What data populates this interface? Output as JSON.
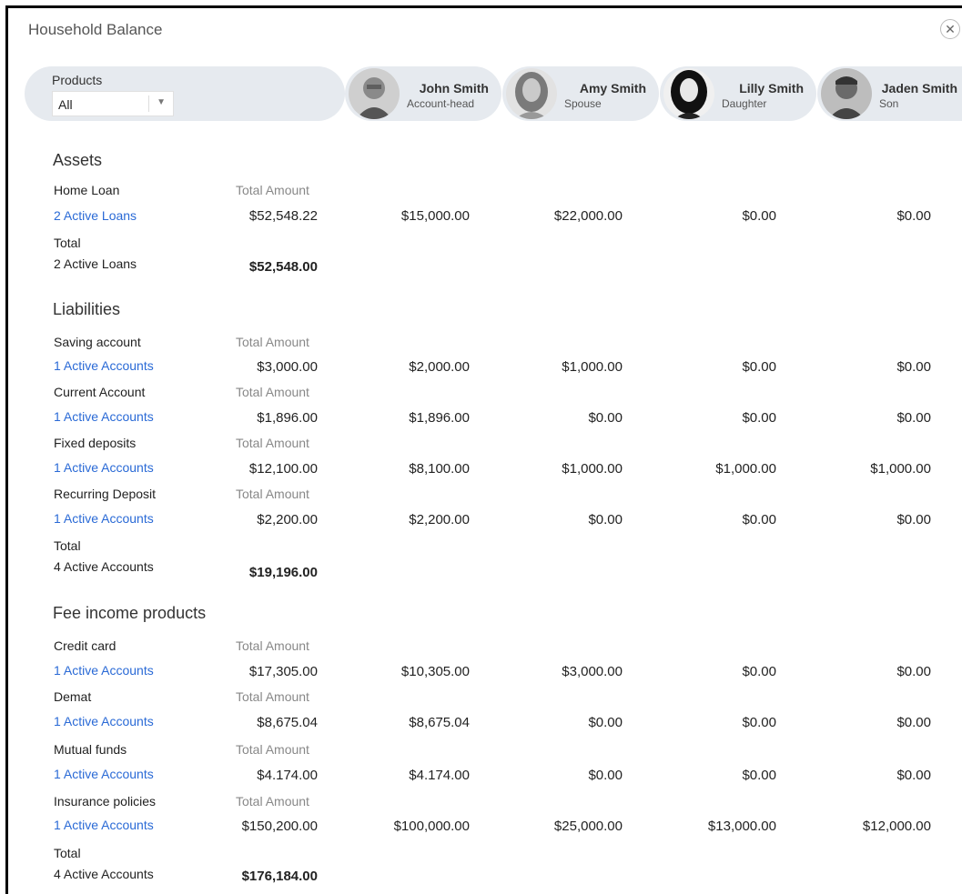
{
  "window": {
    "title": "Household Balance",
    "close_icon": "close-icon"
  },
  "filter": {
    "label": "Products",
    "value": "All"
  },
  "members": [
    {
      "name": "John Smith",
      "role": "Account-head"
    },
    {
      "name": "Amy Smith",
      "role": "Spouse"
    },
    {
      "name": "Lilly Smith",
      "role": "Daughter"
    },
    {
      "name": "Jaden Smith",
      "role": "Son"
    }
  ],
  "total_amount_label": "Total Amount",
  "total_label": "Total",
  "sections": [
    {
      "title": "Assets",
      "rows": [
        {
          "label": "Home Loan",
          "link": "2 Active Loans",
          "values": [
            "$52,548.22",
            "$15,000.00",
            "$22,000.00",
            "$0.00",
            "$0.00"
          ]
        }
      ],
      "total_count": "2 Active Loans",
      "total_value": "$52,548.00"
    },
    {
      "title": "Liabilities",
      "rows": [
        {
          "label": "Saving account",
          "link": "1 Active Accounts",
          "values": [
            "$3,000.00",
            "$2,000.00",
            "$1,000.00",
            "$0.00",
            "$0.00"
          ]
        },
        {
          "label": "Current Account",
          "link": "1 Active Accounts",
          "values": [
            "$1,896.00",
            "$1,896.00",
            "$0.00",
            "$0.00",
            "$0.00"
          ]
        },
        {
          "label": "Fixed deposits",
          "link": "1 Active Accounts",
          "values": [
            "$12,100.00",
            "$8,100.00",
            "$1,000.00",
            "$1,000.00",
            "$1,000.00"
          ]
        },
        {
          "label": "Recurring Deposit",
          "link": "1 Active Accounts",
          "values": [
            "$2,200.00",
            "$2,200.00",
            "$0.00",
            "$0.00",
            "$0.00"
          ]
        }
      ],
      "total_count": "4 Active Accounts",
      "total_value": "$19,196.00"
    },
    {
      "title": "Fee income products",
      "rows": [
        {
          "label": "Credit card",
          "link": "1 Active Accounts",
          "values": [
            "$17,305.00",
            "$10,305.00",
            "$3,000.00",
            "$0.00",
            "$0.00"
          ]
        },
        {
          "label": "Demat",
          "link": "1 Active Accounts",
          "values": [
            "$8,675.04",
            "$8,675.04",
            "$0.00",
            "$0.00",
            "$0.00"
          ]
        },
        {
          "label": "Mutual funds",
          "link": "1 Active Accounts",
          "values": [
            "$4.174.00",
            "$4.174.00",
            "$0.00",
            "$0.00",
            "$0.00"
          ]
        },
        {
          "label": "Insurance policies",
          "link": "1 Active Accounts",
          "values": [
            "$150,200.00",
            "$100,000.00",
            "$25,000.00",
            "$13,000.00",
            "$12,000.00"
          ]
        }
      ],
      "total_count": "4 Active Accounts",
      "total_value": "$176,184.00"
    }
  ]
}
